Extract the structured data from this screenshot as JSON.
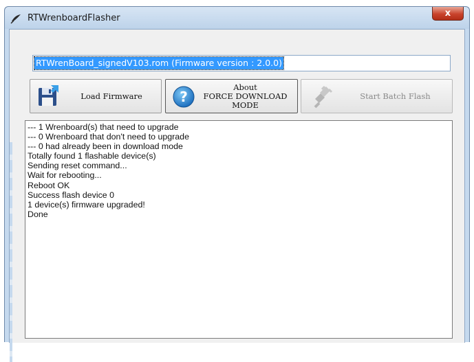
{
  "window": {
    "title": "RTWrenboardFlasher",
    "close_glyph": "x"
  },
  "file_field": {
    "value": "RTWrenBoard_signedV103.rom (Firmware version : 2.0.0)"
  },
  "toolbar": {
    "load_label": "Load Firmware",
    "about_line1": "About",
    "about_line2": "FORCE DOWNLOAD MODE",
    "batch_label": "Start Batch Flash"
  },
  "icons": {
    "app": "feather-icon",
    "load": "floppy-disk-icon",
    "about": "help-question-icon",
    "batch": "usb-plug-icon"
  },
  "log": {
    "lines": [
      "--- 1 Wrenboard(s) that need to upgrade",
      "--- 0 Wrenboard that don't need to upgrade",
      "--- 0 had already been in download mode",
      "Totally found 1 flashable device(s)",
      "Sending reset command...",
      "Wait for rebooting...",
      "Reboot OK",
      "Success flash device 0",
      "1 device(s) firmware upgraded!",
      "Done"
    ]
  },
  "colors": {
    "selection": "#3399ff",
    "frame": "#c5d9ee",
    "close": "#c9432c"
  }
}
